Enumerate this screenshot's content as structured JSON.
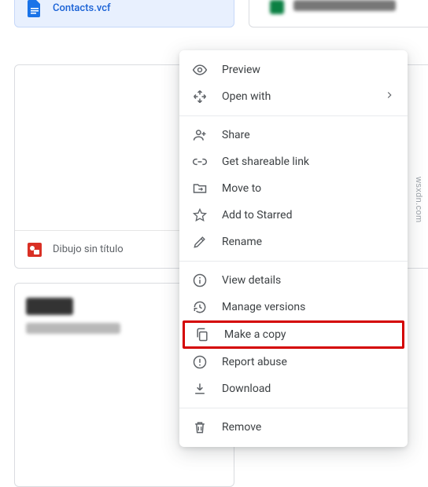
{
  "files": {
    "selected": {
      "name": "Contacts.vcf",
      "icon": "file-doc-icon",
      "color": "#1a73e8"
    },
    "drawing": {
      "name": "Dibujo sin título",
      "icon": "drawing-icon",
      "color": "#d93025"
    }
  },
  "watermark": "wsxdn.com",
  "context_menu": {
    "sections": [
      [
        {
          "id": "preview",
          "label": "Preview",
          "icon": "eye-icon"
        },
        {
          "id": "open_with",
          "label": "Open with",
          "icon": "expand-icon",
          "has_submenu": true
        }
      ],
      [
        {
          "id": "share",
          "label": "Share",
          "icon": "person-add-icon"
        },
        {
          "id": "link",
          "label": "Get shareable link",
          "icon": "link-icon"
        },
        {
          "id": "move",
          "label": "Move to",
          "icon": "move-folder-icon"
        },
        {
          "id": "star",
          "label": "Add to Starred",
          "icon": "star-icon"
        },
        {
          "id": "rename",
          "label": "Rename",
          "icon": "pencil-icon"
        }
      ],
      [
        {
          "id": "details",
          "label": "View details",
          "icon": "info-icon"
        },
        {
          "id": "versions",
          "label": "Manage versions",
          "icon": "history-icon"
        },
        {
          "id": "copy",
          "label": "Make a copy",
          "icon": "copy-icon",
          "highlight": true
        },
        {
          "id": "abuse",
          "label": "Report abuse",
          "icon": "warning-icon"
        },
        {
          "id": "download",
          "label": "Download",
          "icon": "download-icon"
        }
      ],
      [
        {
          "id": "remove",
          "label": "Remove",
          "icon": "trash-icon"
        }
      ]
    ]
  }
}
